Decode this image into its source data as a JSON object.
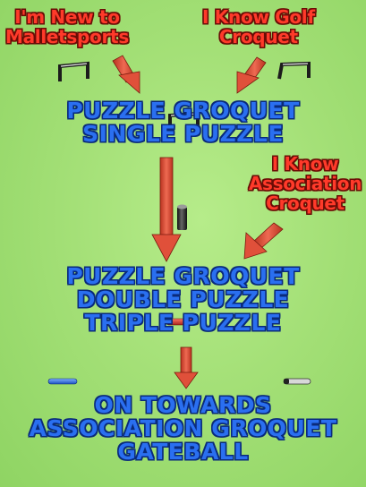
{
  "starting_points": {
    "new_to_malletsports": [
      "I'm New to",
      "Malletsports"
    ],
    "know_golf_croquet": [
      "I Know Golf",
      "Croquet"
    ],
    "know_association_croquet": [
      "I Know",
      "Association",
      "Croquet"
    ]
  },
  "stages": {
    "single": [
      "PUZZLE GROQUET",
      "SINGLE PUZZLE"
    ],
    "double_triple": [
      "PUZZLE GROQUET",
      "DOUBLE PUZZLE",
      "TRIPLE PUZZLE"
    ],
    "advanced": [
      "ON TOWARDS",
      "ASSOCIATION GROQUET",
      "GATEBALL"
    ]
  },
  "colors": {
    "background": "#a4e077",
    "start_label": "#ff3a2a",
    "stage_text": "#2a6ff0",
    "arrow": "#e0503a",
    "hoop": "#1c1c1c",
    "peg": "#2a2a2a",
    "mallet_blue": "#2a6ff0",
    "mallet_red": "#d63a2a"
  },
  "icons": {
    "hoop": "hoop-icon",
    "peg": "peg-icon",
    "mallet": "mallet-icon",
    "arrow": "arrow-icon"
  }
}
